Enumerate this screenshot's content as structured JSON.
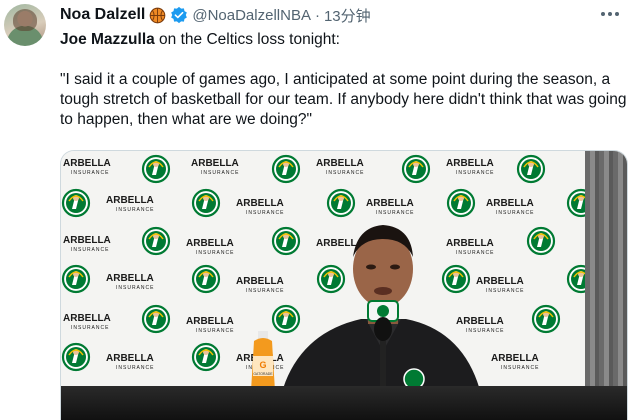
{
  "tweet": {
    "display_name": "Noa Dalzell",
    "handle": "@NoaDalzellNBA",
    "separator": "·",
    "time": "13分钟",
    "text_subject": "Joe Mazzulla",
    "text_rest": " on the Celtics loss tonight:",
    "quote": "\"I said it a couple of games ago, I anticipated at some point during the season, a tough stretch of basketball for our team. If anybody here didn't think that was going to happen, then what are we doing?\""
  },
  "media": {
    "sponsor_name": "ARBELLA",
    "sponsor_sub": "INSURANCE",
    "bottle_brand": "G",
    "bottle_label": "GATORADE",
    "colors": {
      "celtics_green": "#007a33",
      "verified_blue": "#1d9bf0",
      "gatorade_orange": "#f39a1e"
    }
  },
  "icons": {
    "emoji": "basketball-icon",
    "verified": "verified-badge-icon",
    "more": "more-icon"
  }
}
